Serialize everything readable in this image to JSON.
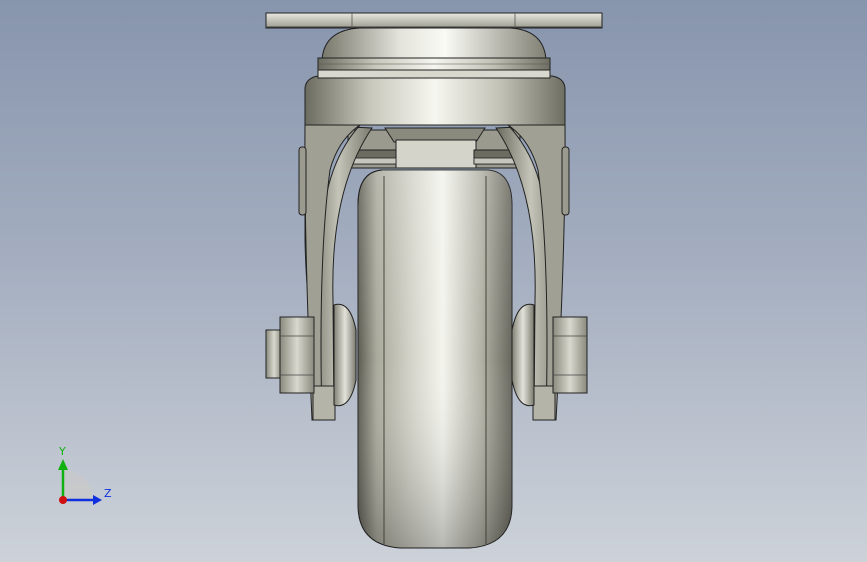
{
  "colors": {
    "background_top": "#8795ad",
    "background_bottom": "#cdd2d9",
    "part_dark": "#5a5a4e",
    "part_mid": "#a8a89a",
    "part_light": "#f2f2ea",
    "axis_x": "#d01010",
    "axis_y": "#10b010",
    "axis_z": "#1030e0"
  },
  "triad": {
    "y_label": "Y",
    "z_label": "Z"
  },
  "model": {
    "parts": [
      "mounting-plate",
      "swivel-housing",
      "fork",
      "wheel",
      "axle-nut-left",
      "axle-nut-right"
    ]
  }
}
